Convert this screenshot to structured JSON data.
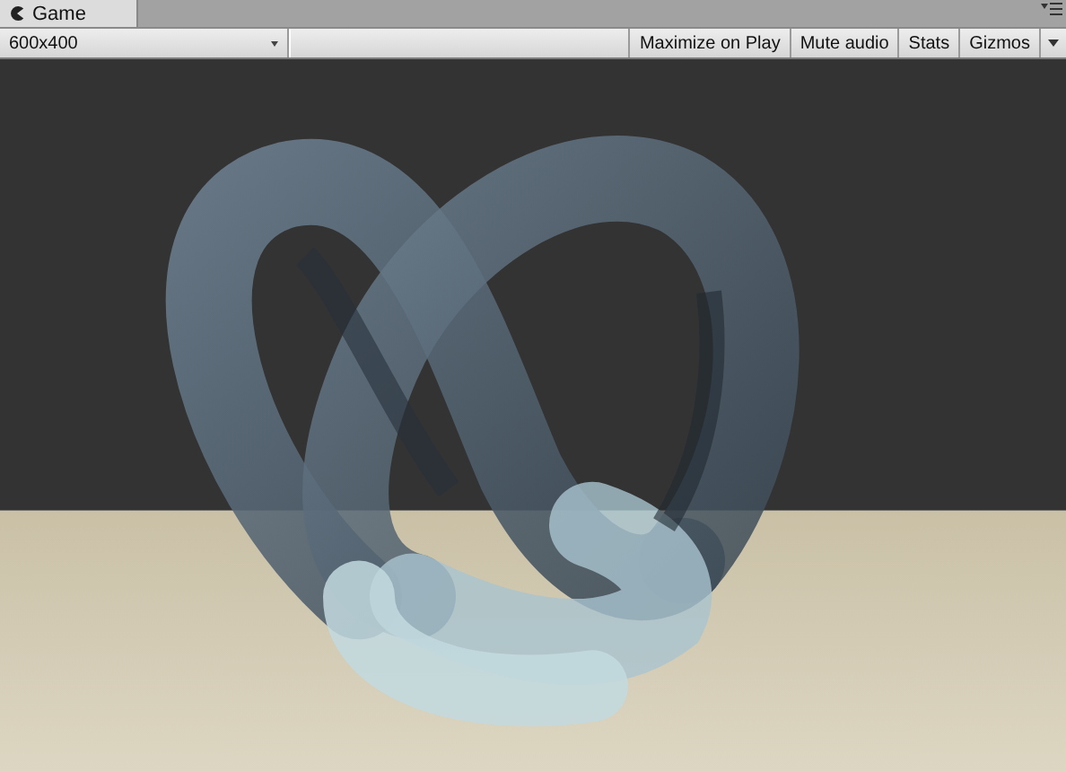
{
  "tabs": [
    {
      "label": "Game",
      "selected": true
    }
  ],
  "toolbar": {
    "resolution": "600x400",
    "buttons": [
      {
        "label": "Maximize on Play",
        "on": false
      },
      {
        "label": "Mute audio",
        "on": false
      },
      {
        "label": "Stats",
        "on": false
      },
      {
        "label": "Gizmos",
        "on": false
      }
    ]
  }
}
